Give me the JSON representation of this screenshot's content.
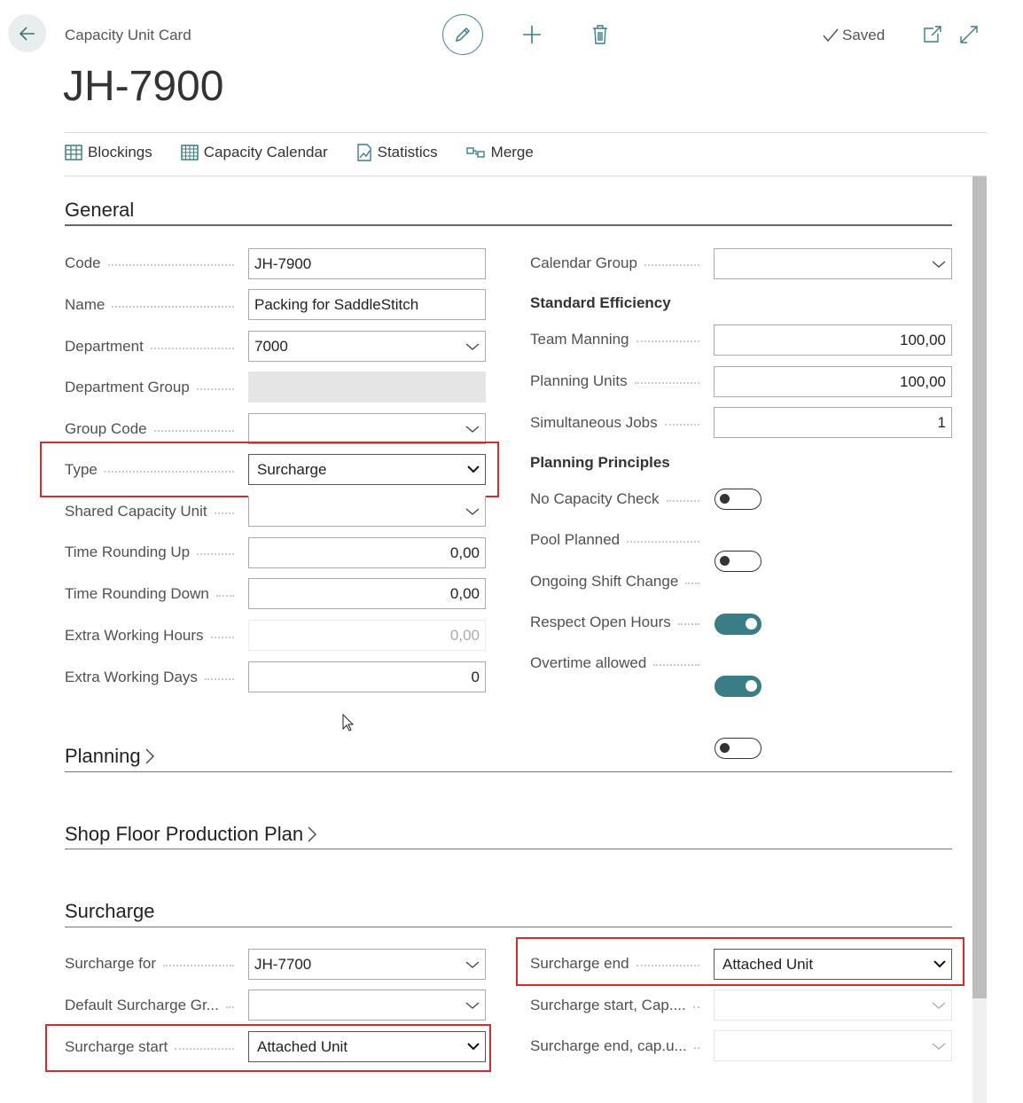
{
  "header": {
    "breadcrumb": "Capacity Unit Card",
    "title": "JH-7900",
    "saved_label": "Saved"
  },
  "actions": [
    {
      "label": "Blockings",
      "icon": "grid-icon"
    },
    {
      "label": "Capacity Calendar",
      "icon": "calendar-icon"
    },
    {
      "label": "Statistics",
      "icon": "statistics-icon"
    },
    {
      "label": "Merge",
      "icon": "merge-icon"
    }
  ],
  "general": {
    "title": "General",
    "code": {
      "label": "Code",
      "value": "JH-7900"
    },
    "name": {
      "label": "Name",
      "value": "Packing for SaddleStitch"
    },
    "department": {
      "label": "Department",
      "value": "7000"
    },
    "department_group": {
      "label": "Department Group",
      "value": ""
    },
    "group_code": {
      "label": "Group Code",
      "value": ""
    },
    "type": {
      "label": "Type",
      "value": "Surcharge"
    },
    "shared_capacity_unit": {
      "label": "Shared Capacity Unit",
      "value": ""
    },
    "time_rounding_up": {
      "label": "Time Rounding Up",
      "value": "0,00"
    },
    "time_rounding_down": {
      "label": "Time Rounding Down",
      "value": "0,00"
    },
    "extra_working_hours": {
      "label": "Extra Working Hours",
      "value": "0,00"
    },
    "extra_working_days": {
      "label": "Extra Working Days",
      "value": "0"
    },
    "calendar_group": {
      "label": "Calendar Group",
      "value": ""
    },
    "standard_efficiency_heading": "Standard Efficiency",
    "team_manning": {
      "label": "Team Manning",
      "value": "100,00"
    },
    "planning_units": {
      "label": "Planning Units",
      "value": "100,00"
    },
    "simultaneous_jobs": {
      "label": "Simultaneous Jobs",
      "value": "1"
    },
    "planning_principles_heading": "Planning Principles",
    "no_capacity_check": {
      "label": "No Capacity Check",
      "on": false
    },
    "pool_planned": {
      "label": "Pool Planned",
      "on": false
    },
    "ongoing_shift_change": {
      "label": "Ongoing Shift Change",
      "on": true
    },
    "respect_open_hours": {
      "label": "Respect Open Hours",
      "on": true
    },
    "overtime_allowed": {
      "label": "Overtime allowed",
      "on": false
    }
  },
  "planning": {
    "title": "Planning"
  },
  "shop_floor": {
    "title": "Shop Floor Production Plan"
  },
  "surcharge": {
    "title": "Surcharge",
    "surcharge_for": {
      "label": "Surcharge for",
      "value": "JH-7700"
    },
    "default_surcharge_group": {
      "label": "Default Surcharge Gr...",
      "value": ""
    },
    "surcharge_start": {
      "label": "Surcharge start",
      "value": "Attached Unit"
    },
    "surcharge_end": {
      "label": "Surcharge end",
      "value": "Attached Unit"
    },
    "surcharge_start_cap": {
      "label": "Surcharge start, Cap....",
      "value": ""
    },
    "surcharge_end_cap": {
      "label": "Surcharge end, cap.u...",
      "value": ""
    }
  },
  "colors": {
    "accent": "#3b7d86",
    "highlight": "#d42c2c"
  }
}
